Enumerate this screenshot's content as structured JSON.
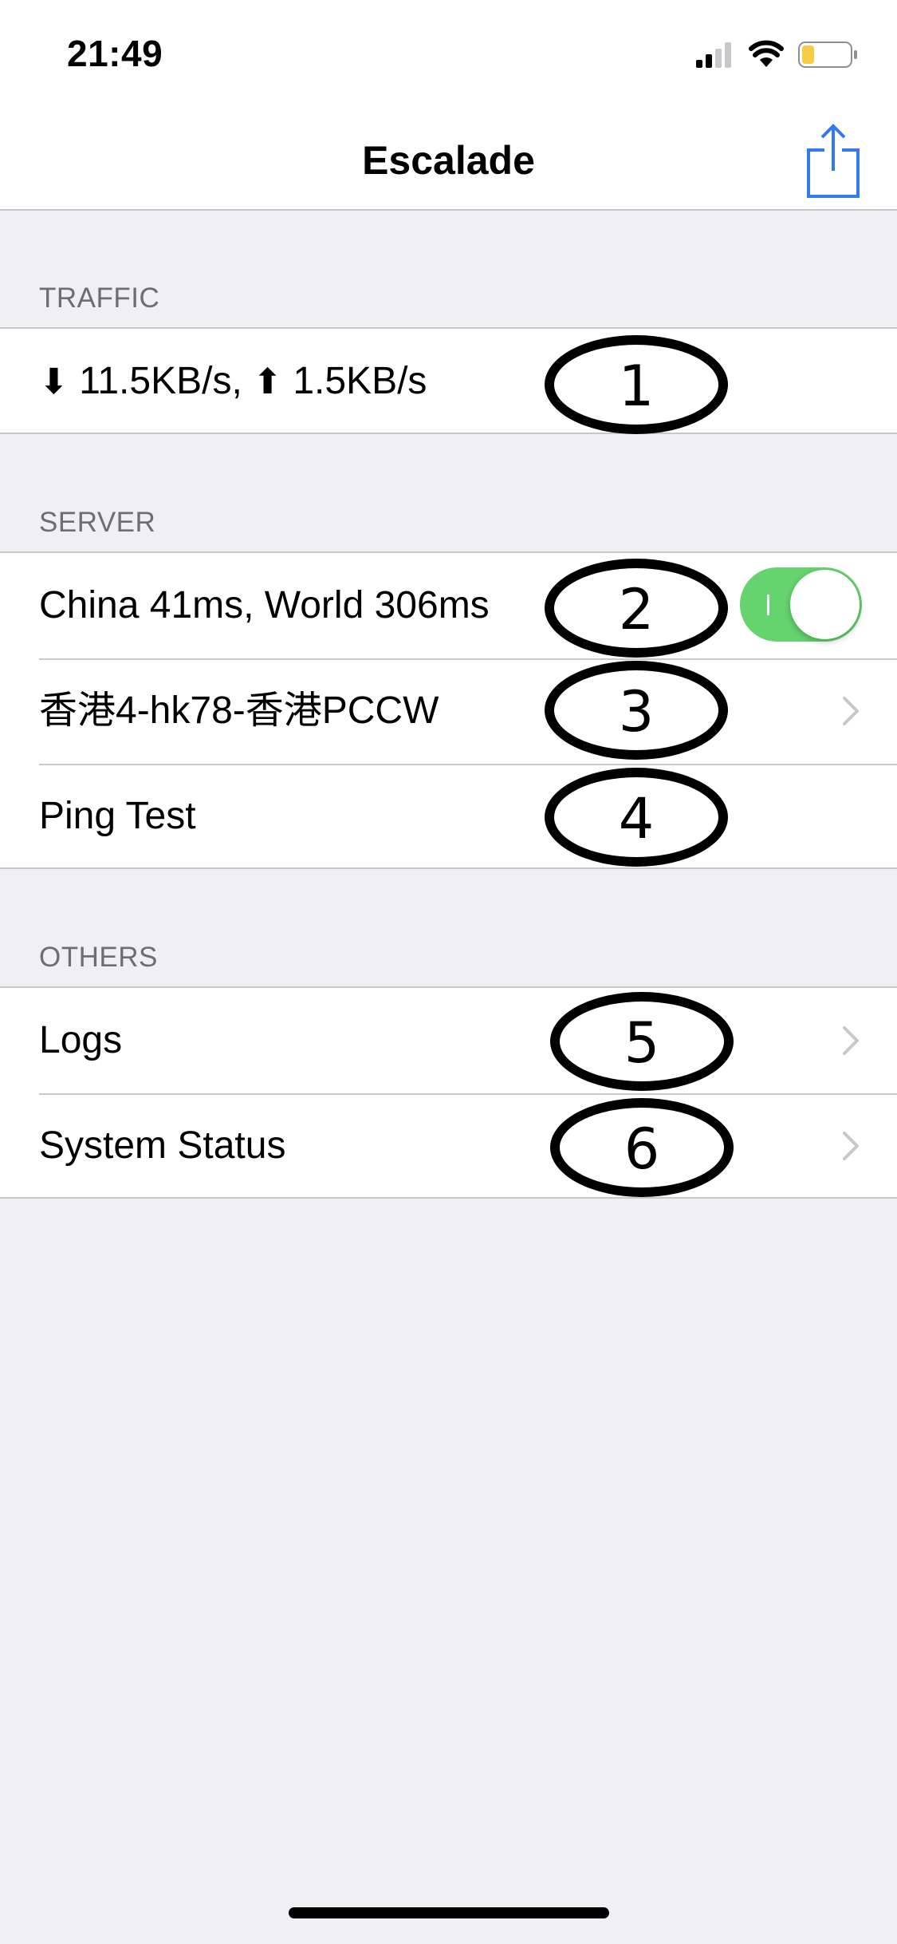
{
  "status_bar": {
    "time": "21:49"
  },
  "nav": {
    "title": "Escalade",
    "share_icon": "share-icon"
  },
  "sections": {
    "traffic": {
      "header": "TRAFFIC",
      "rows": {
        "speed": {
          "down_arrow": "⬇",
          "down_text": " 11.5KB/s, ",
          "up_arrow": "⬆",
          "up_text": " 1.5KB/s"
        }
      }
    },
    "server": {
      "header": "SERVER",
      "rows": {
        "latency": "China 41ms, World 306ms",
        "selected_server": "香港4-hk78-香港PCCW",
        "ping_test": "Ping Test"
      },
      "toggle_on": true
    },
    "others": {
      "header": "OTHERS",
      "rows": {
        "logs": "Logs",
        "system_status": "System Status"
      }
    }
  },
  "annotations": [
    "1",
    "2",
    "3",
    "4",
    "5",
    "6"
  ],
  "colors": {
    "accent": "#3478f6",
    "toggle_on": "#65d36e",
    "background": "#efeff4",
    "separator": "#c8c7cc",
    "section_header": "#6d6d72"
  }
}
